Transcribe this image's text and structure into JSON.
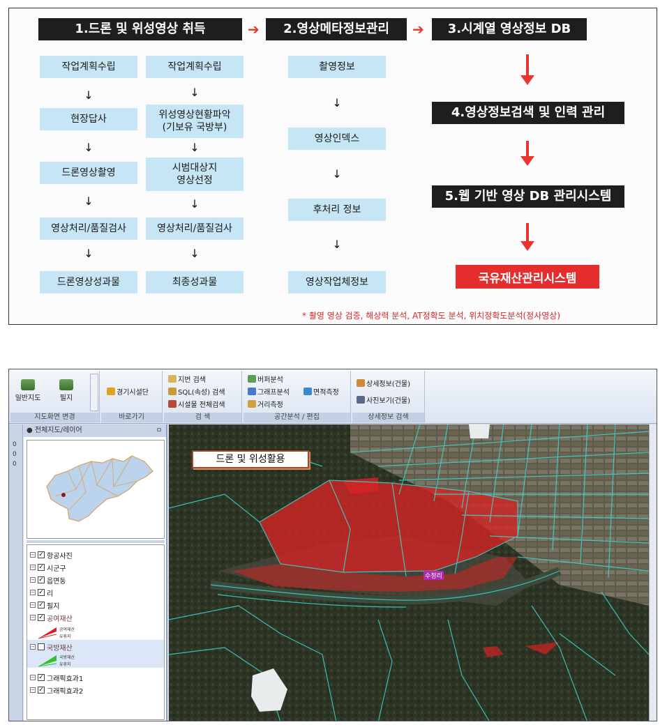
{
  "diagram": {
    "headers": [
      "1.드론 및 위성영상 취득",
      "2.영상메타정보관리",
      "3.시계열 영상정보 DB"
    ],
    "col1": [
      "작업계획수립",
      "현장답사",
      "드론영상촬영",
      "영상처리/품질검사",
      "드론영상성과물"
    ],
    "col2": [
      "작업계획수립",
      "위성영상현황파악\n(기보유 국방부)",
      "시범대상지\n영상선정",
      "영상처리/품질검사",
      "최종성과물"
    ],
    "col3": [
      "촬영정보",
      "영상인덱스",
      "후처리 정보",
      "영상작업체정보"
    ],
    "right_steps": [
      "4.영상정보검색 및 인력 관리",
      "5.웹 기반 영상 DB 관리시스템"
    ],
    "final_box": "국유재산관리시스템",
    "footnote": "* 촬영 영상 검증, 해상력 분석, AT정확도 분석, 위치정확도분석(정사영상)",
    "accent_color": "#e8362e"
  },
  "gis": {
    "ribbon": {
      "group1": {
        "items": [
          "일반지도",
          "필지"
        ],
        "label": "지도화면 변경"
      },
      "group2": {
        "items": [
          "경기시설단"
        ],
        "label": "바로가기"
      },
      "group3": {
        "items": [
          "지번 검색",
          "SQL(속성) 검색",
          "시설물 전체검색"
        ],
        "label": "검 색"
      },
      "group4": {
        "items": [
          "버퍼분석",
          "그래프분석",
          "면적측정",
          "거리측정"
        ],
        "label": "공간분석 / 편집"
      },
      "group5": {
        "items": [
          "상세정보(건물)",
          "사진보기(건물)"
        ],
        "label": "상세정보 검색"
      }
    },
    "panel_title": "전체지도/레이어",
    "panel_pin": "ㅁ",
    "left_strip": [
      "0",
      "0",
      "0"
    ],
    "layers": [
      {
        "name": "항공사진",
        "checked": true
      },
      {
        "name": "시군구",
        "checked": true
      },
      {
        "name": "읍면동",
        "checked": true
      },
      {
        "name": "리",
        "checked": true
      },
      {
        "name": "필지",
        "checked": true
      },
      {
        "name": "공여재산",
        "checked": true,
        "legend": [
          "공여재산",
          "유휴지"
        ]
      },
      {
        "name": "국방재산",
        "checked": false,
        "legend": [
          "국방재산",
          "유휴지"
        ]
      },
      {
        "name": "그래픽효과1",
        "checked": true
      },
      {
        "name": "그래픽효과2",
        "checked": true
      }
    ],
    "map_label": "드론 및 위성활용",
    "map_place_label": "수정리",
    "map_highlight_color": "#d62424"
  }
}
